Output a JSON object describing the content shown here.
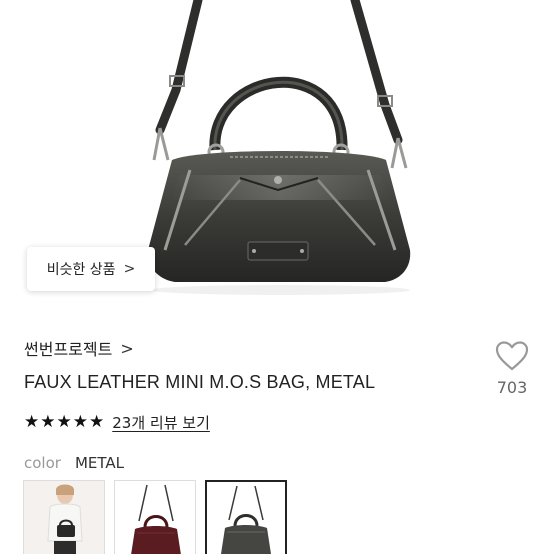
{
  "similar_button": {
    "label": "비슷한 상품",
    "chevron": ">"
  },
  "brand": {
    "name": "썬번프로젝트",
    "chevron": ">"
  },
  "product": {
    "title": "FAUX LEATHER MINI M.O.S BAG, METAL"
  },
  "like": {
    "icon": "heart-outline-icon",
    "count": "703"
  },
  "rating": {
    "stars": 5,
    "star_glyph": "★",
    "review_label": "23개 리뷰 보기"
  },
  "color": {
    "label": "color",
    "value": "METAL"
  },
  "thumbnails": [
    {
      "name": "model-wearing-bag",
      "selected": false
    },
    {
      "name": "burgundy-bag",
      "selected": false
    },
    {
      "name": "metal-bag",
      "selected": true
    }
  ],
  "colors": {
    "bag_metal": "#3d3d3a",
    "bag_burgundy": "#5a1c20",
    "text_primary": "#222222",
    "text_muted": "#999999"
  }
}
